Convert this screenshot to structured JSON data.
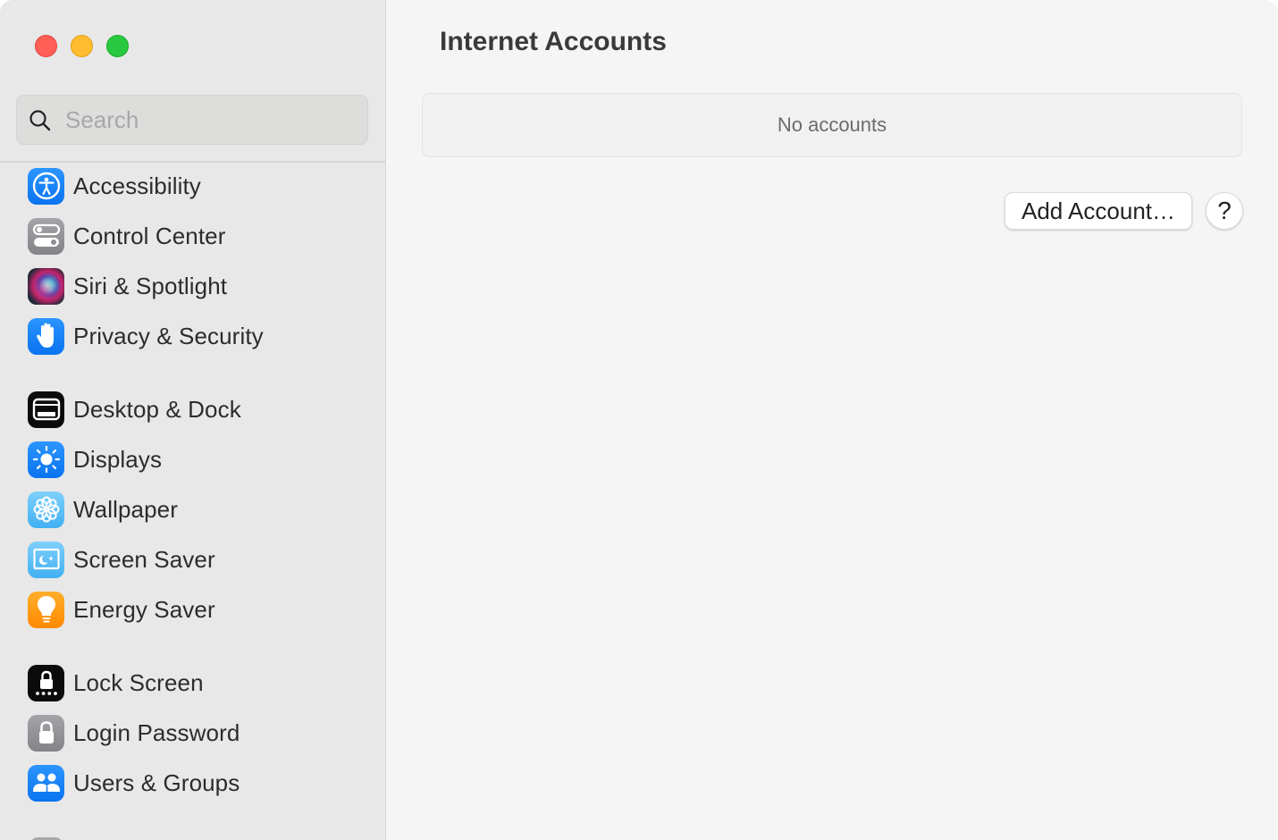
{
  "window": {
    "traffic_lights": {
      "close": "close-button",
      "minimize": "minimize-button",
      "zoom": "zoom-button"
    },
    "colors": {
      "close": "#ff5f57",
      "minimize": "#febc2e",
      "zoom": "#28c840",
      "sidebar_bg": "#e8e8e8",
      "content_bg": "#f5f5f5",
      "accent_blue": "#1a82fb"
    }
  },
  "search": {
    "placeholder": "Search",
    "value": "",
    "icon": "magnifying-glass-icon"
  },
  "sidebar": {
    "items": [
      {
        "label": "Accessibility",
        "icon": "accessibility-icon"
      },
      {
        "label": "Control Center",
        "icon": "control-center-icon"
      },
      {
        "label": "Siri & Spotlight",
        "icon": "siri-icon"
      },
      {
        "label": "Privacy & Security",
        "icon": "hand-icon"
      },
      {
        "label": "Desktop & Dock",
        "icon": "desktop-dock-icon"
      },
      {
        "label": "Displays",
        "icon": "sun-icon"
      },
      {
        "label": "Wallpaper",
        "icon": "flower-icon"
      },
      {
        "label": "Screen Saver",
        "icon": "screen-saver-icon"
      },
      {
        "label": "Energy Saver",
        "icon": "lightbulb-icon"
      },
      {
        "label": "Lock Screen",
        "icon": "lock-screen-icon"
      },
      {
        "label": "Login Password",
        "icon": "lock-icon"
      },
      {
        "label": "Users & Groups",
        "icon": "users-icon"
      }
    ]
  },
  "main": {
    "title": "Internet Accounts",
    "empty_message": "No accounts",
    "add_account_label": "Add Account…",
    "help_label": "?"
  }
}
